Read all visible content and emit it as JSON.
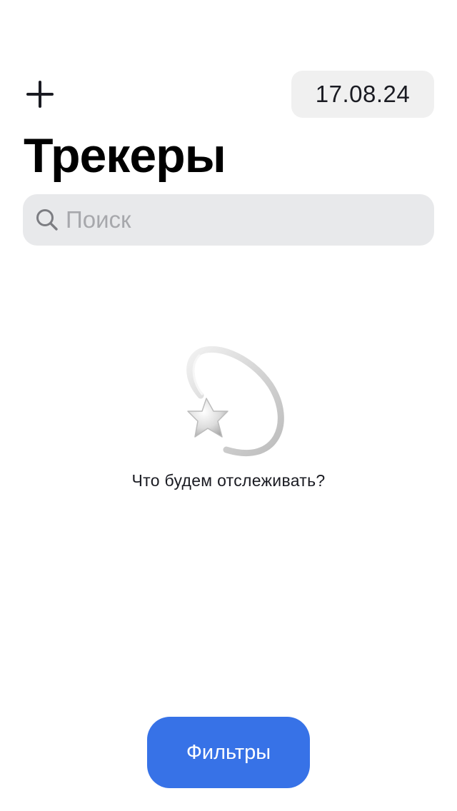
{
  "header": {
    "add_icon": "plus-icon",
    "date": "17.08.24"
  },
  "title": "Трекеры",
  "search": {
    "placeholder": "Поиск",
    "value": "",
    "icon": "magnifier-icon"
  },
  "empty_state": {
    "illustration": "dizzy-star-icon",
    "message": "Что будем отслеживать?"
  },
  "filters_button": {
    "label": "Фильтры",
    "color": "#3772E7"
  },
  "colors": {
    "text": "#1A1B22",
    "search_bg": "#E8E9EB",
    "placeholder": "#A7A8AC",
    "date_bg": "#F0F0F0"
  }
}
